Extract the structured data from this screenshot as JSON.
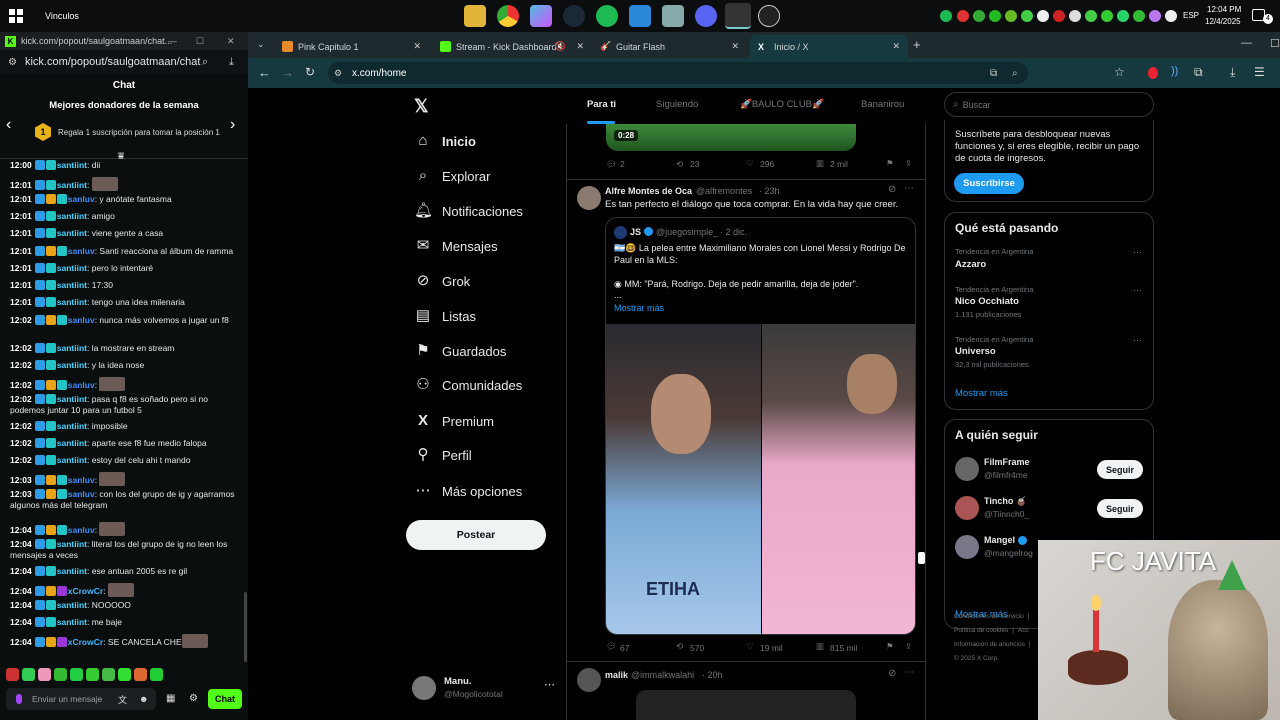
{
  "taskbar": {
    "widget_label": "Vinculos",
    "lang": "ESP",
    "time": "12:04 PM",
    "date": "12/4/2025",
    "notif_count": "4"
  },
  "kick": {
    "window_url": "kick.com/popout/saulgoatmaan/chat...",
    "address": "kick.com/popout/saulgoatmaan/chat",
    "chat_title": "Chat",
    "top_donors_title": "Mejores donadores de la semana",
    "donor_rank": "1",
    "donor_prompt": "Regala 1 suscripción para tomar la posición 1",
    "messages": [
      {
        "time": "12:00",
        "user": "santiint",
        "text": "dii"
      },
      {
        "time": "12:01",
        "user": "santiint",
        "text": ""
      },
      {
        "time": "12:01",
        "user": "sanluv",
        "text": "y anótate fantasma"
      },
      {
        "time": "12:01",
        "user": "santiint",
        "text": "amigo"
      },
      {
        "time": "12:01",
        "user": "santiint",
        "text": "viene gente a casa"
      },
      {
        "time": "12:01",
        "user": "sanluv",
        "text": "Santi reacciona al álbum de ramma"
      },
      {
        "time": "12:01",
        "user": "santiint",
        "text": "pero lo intentaré"
      },
      {
        "time": "12:01",
        "user": "santiint",
        "text": "17:30"
      },
      {
        "time": "12:01",
        "user": "santiint",
        "text": "tengo una idea milenaria"
      },
      {
        "time": "12:02",
        "user": "sanluv",
        "text": "nunca más volvemos a jugar un f8"
      },
      {
        "time": "12:02",
        "user": "santiint",
        "text": "la mostrare en stream"
      },
      {
        "time": "12:02",
        "user": "santiint",
        "text": "y la idea nose"
      },
      {
        "time": "12:02",
        "user": "sanluv",
        "text": ""
      },
      {
        "time": "12:02",
        "user": "santiint",
        "text": "pasa q f8 es soñado pero si no podemos juntar 10 para un futbol 5"
      },
      {
        "time": "12:02",
        "user": "santiint",
        "text": "imposible"
      },
      {
        "time": "12:02",
        "user": "santiint",
        "text": "aparte ese f8 fue medio falopa"
      },
      {
        "time": "12:02",
        "user": "santiint",
        "text": "estoy del celu ahi t mando"
      },
      {
        "time": "12:03",
        "user": "sanluv",
        "text": ""
      },
      {
        "time": "12:03",
        "user": "sanluv",
        "text": "con los del grupo de ig y agarramos algunos más del telegram"
      },
      {
        "time": "12:04",
        "user": "sanluv",
        "text": ""
      },
      {
        "time": "12:04",
        "user": "santiint",
        "text": "literal los del grupo de ig no leen los mensajes a veces"
      },
      {
        "time": "12:04",
        "user": "santiint",
        "text": "ese antuan 2005 es re gil"
      },
      {
        "time": "12:04",
        "user": "xCrowCr",
        "text": ""
      },
      {
        "time": "12:04",
        "user": "santiint",
        "text": "NOOOOO"
      },
      {
        "time": "12:04",
        "user": "santiint",
        "text": "me baje"
      },
      {
        "time": "12:04",
        "user": "xCrowCr",
        "text": "SE CANCELA CHE"
      }
    ],
    "input_placeholder": "Enviar un mensaje",
    "send_label": "Chat"
  },
  "browser": {
    "tabs": [
      {
        "label": "Pink Capitulo 1"
      },
      {
        "label": "Stream - Kick Dashboard"
      },
      {
        "label": "Guitar Flash"
      },
      {
        "label": "Inicio / X"
      }
    ],
    "url": "x.com/home"
  },
  "x": {
    "nav": [
      "Inicio",
      "Explorar",
      "Notificaciones",
      "Mensajes",
      "Grok",
      "Listas",
      "Guardados",
      "Comunidades",
      "Premium",
      "Perfil",
      "Más opciones"
    ],
    "post_button": "Postear",
    "account": {
      "name": "Manu.",
      "handle": "@Mogolicototal"
    },
    "feed_tabs": [
      "Para ti",
      "Siguiendo",
      "🚀BAULO CLUB🚀",
      "Bananirou"
    ],
    "video_time": "0:28",
    "post0_metrics": {
      "replies": "2",
      "reposts": "23",
      "likes": "296",
      "views": "2 mil"
    },
    "post1": {
      "author": "Alfre Montes de Oca",
      "handle": "@alfremontes",
      "time": "· 23h",
      "text": "Es tan perfecto el diálogo que toca comprar. En la vida hay que creer.",
      "quote": {
        "author": "JS",
        "handle": "@juegosimple_",
        "time": "· 2 dic.",
        "text1": "🇦🇷🤓 La pelea entre Maximiliano Morales con Lionel Messi y Rodrigo De Paul en la MLS:",
        "text2": "◉ MM: \"Pará, Rodrigo. Deja de pedir amarilla, deja de joder\".",
        "ellipsis": "...",
        "more": "Mostrar más"
      },
      "metrics": {
        "replies": "67",
        "reposts": "570",
        "likes": "19 mil",
        "views": "815 mil"
      }
    },
    "post2": {
      "author": "malik",
      "handle": "@immalkwalahi",
      "time": "· 20h"
    },
    "search_placeholder": "Buscar",
    "premium_text": "Suscríbete para desbloquear nuevas funciones y, si eres elegible, recibir un pago de cuota de ingresos.",
    "premium_button": "Suscribirse",
    "trends_title": "Qué está pasando",
    "trends": [
      {
        "context": "Tendencia en Argentina",
        "name": "Azzaro",
        "count": ""
      },
      {
        "context": "Tendencia en Argentina",
        "name": "Nico Occhiato",
        "count": "1.131 publicaciones"
      },
      {
        "context": "Tendencia en Argentina",
        "name": "Universo",
        "count": "32,3 mil publicaciones"
      }
    ],
    "show_more": "Mostrar más",
    "who_to_follow_title": "A quién seguir",
    "follow": [
      {
        "name": "FilmFrame",
        "handle": "@filmfr4me",
        "btn": "Seguir"
      },
      {
        "name": "Tincho 🧉",
        "handle": "@Tiinnch0_",
        "btn": "Seguir"
      },
      {
        "name": "Mangel",
        "handle": "@mangelrog",
        "btn": ""
      }
    ],
    "footer": [
      "Condiciones de Servicio",
      "Política de cookies",
      "Acc",
      "Información de anuncios",
      "© 2025 X Corp."
    ]
  },
  "overlay": {
    "title": "FC JAVITA"
  }
}
